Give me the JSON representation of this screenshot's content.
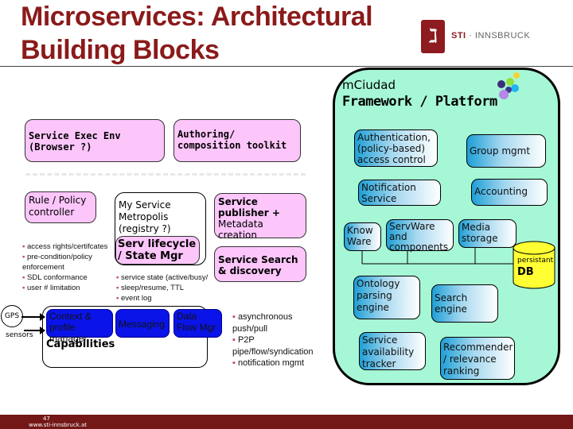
{
  "slide": {
    "title_line1": "Microservices: Architectural",
    "title_line2": "Building Blocks",
    "logo_brand": "STI",
    "logo_sep": " · ",
    "logo_city": "INNSBRUCK",
    "logo_glyph": "ℷ",
    "page_number": "47",
    "footer_url": "www.sti-innsbruck.at"
  },
  "platform": {
    "subtitle": "mCiudad",
    "title": "Framework / Platform",
    "boxes": [
      {
        "label": "Authentication, (policy-based) access control"
      },
      {
        "label": "Group mgmt"
      },
      {
        "label": "Notification Service"
      },
      {
        "label": "Accounting"
      },
      {
        "label": "Know Ware"
      },
      {
        "label": "ServWare and components"
      },
      {
        "label": "Media storage"
      },
      {
        "label": "Ontology parsing engine"
      },
      {
        "label": "Search engine"
      },
      {
        "label": "Service availability tracker"
      },
      {
        "label": "Recommender / relevance ranking"
      }
    ],
    "db": {
      "small": "persistant",
      "big": "DB"
    },
    "colors": {
      "background": "#a6f7d6",
      "box_gradient_start": "#1e9fd6",
      "db": "#ffff33"
    }
  },
  "client": {
    "exec_env": "Service Exec Env (Browser ?)",
    "authoring": "Authoring/ composition toolkit",
    "rule_policy": "Rule / Policy controller",
    "rule_bullets": [
      "access rights/certifcates",
      "pre-condition/policy enforcement",
      "SDL conformance",
      "user # limitation"
    ],
    "metropolis": "My Service Metropolis (registry ?)",
    "lifecycle": "Serv lifecycle / State Mgr",
    "lifecycle_bullets": [
      "service state (active/busy/",
      "sleep/resume, TTL",
      "event log"
    ],
    "publisher_bold": "Service publisher +",
    "publisher_rest": "Metadata creation",
    "search": "Service Search & discovery",
    "capabilities": "Capabilities",
    "cap_boxes": [
      "Context & profile manager",
      "Messaging",
      "Data Flow Mgr"
    ],
    "messaging_bullets": [
      "asynchronous push/pull",
      "P2P pipe/flow/syndication",
      "notification mgmt"
    ],
    "gps": "GPS",
    "sensors": "sensors",
    "colors": {
      "pink": "#fdc6fb",
      "capability_blue": "#0a14e8",
      "title_red": "#8b1a1a"
    }
  }
}
